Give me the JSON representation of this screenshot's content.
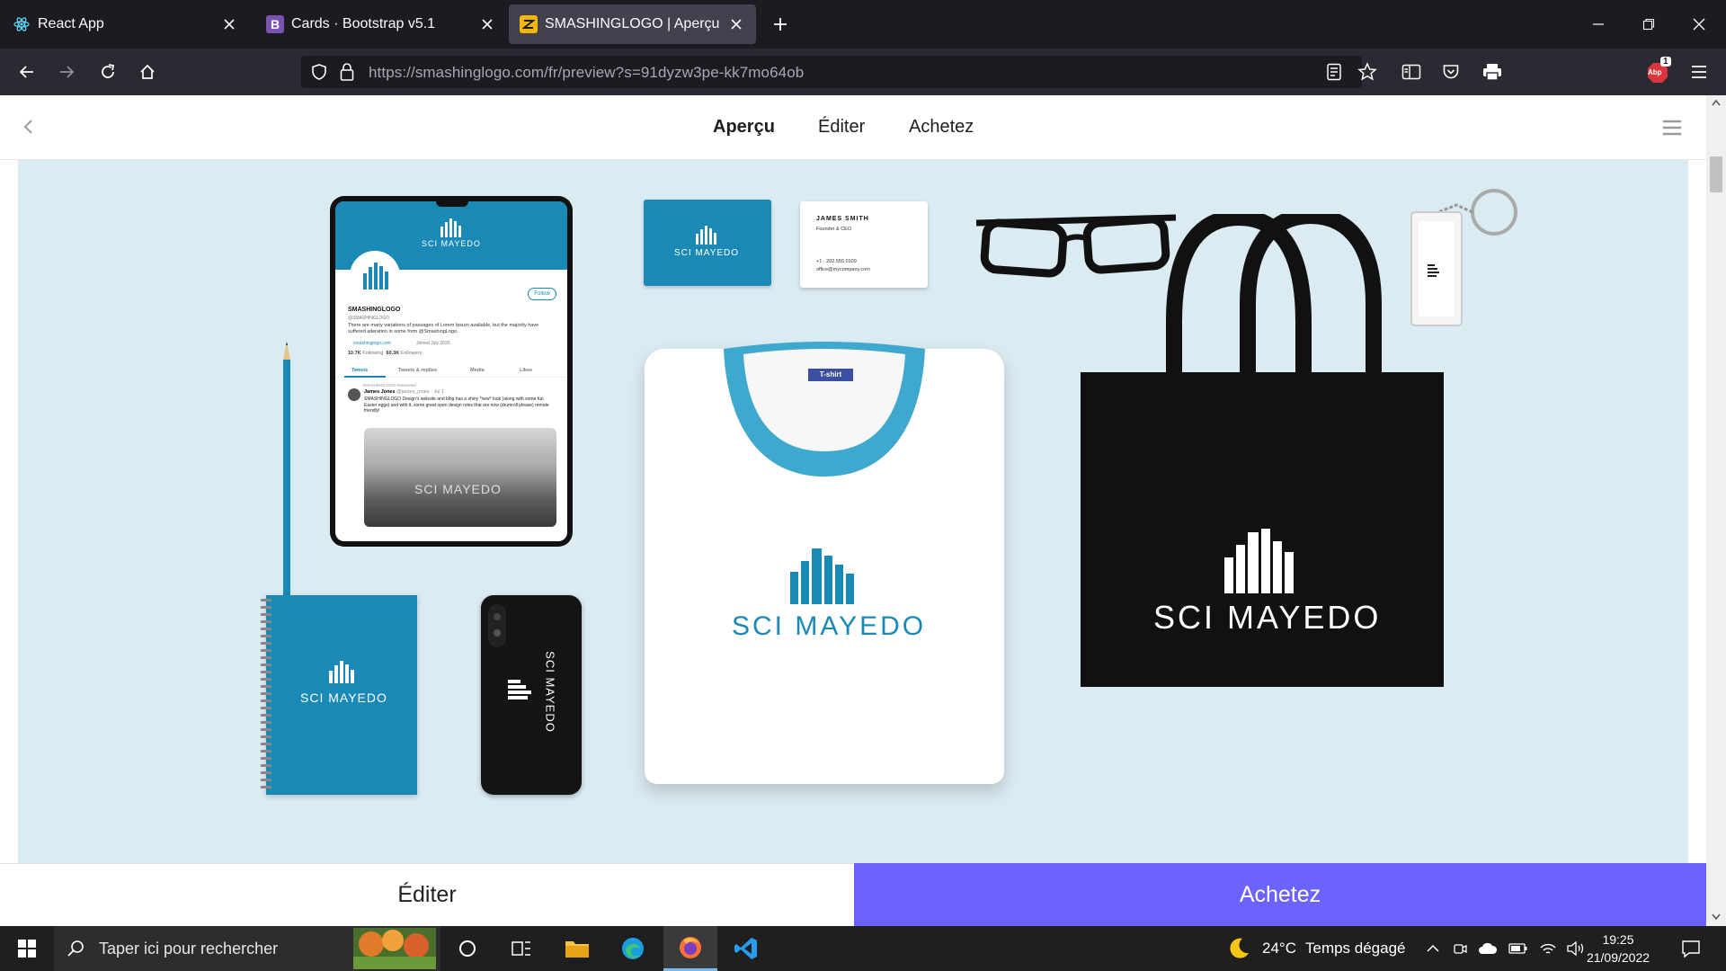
{
  "browser": {
    "tabs": [
      {
        "title": "React App",
        "icon": "react-icon",
        "active": false
      },
      {
        "title": "Cards · Bootstrap v5.1",
        "icon": "bootstrap-icon",
        "active": false
      },
      {
        "title": "SMASHINGLOGO | Aperçu",
        "icon": "smashinglogo-icon",
        "active": true
      }
    ],
    "url_host": "https://smashinglogo.com",
    "url_path": "/fr/preview?s=91dyzw3pe-kk7mo64ob",
    "extension_badge": "1",
    "extension_label": "Abp"
  },
  "site": {
    "nav": {
      "preview": "Aperçu",
      "edit": "Éditer",
      "buy": "Achetez"
    },
    "cta": {
      "edit": "Éditer",
      "buy": "Achetez"
    },
    "accent": "#6c63ff",
    "preview_bg": "#dbebf2",
    "brand_color": "#1a89b5"
  },
  "mockup": {
    "brand_name": "SCI MAYEDO",
    "tablet": {
      "profile_name": "SMASHINGLOGO",
      "handle": "@SMASHINGLOGO",
      "follow": "Follow",
      "bio": "There are many variations of passages of Lorem Ipsum available, but the majority have suffered alteration in some form @SmashingLogo.",
      "link": "smashinglogo.com",
      "joined": "Joined July 2020",
      "following_count": "10.7K",
      "following_label": "Following",
      "followers_count": "60.3K",
      "followers_label": "Followers",
      "tabs": [
        "Tweets",
        "Tweets & replies",
        "Media",
        "Likes"
      ],
      "retweet": "SMASHINGLOGO Retweeted",
      "tweet_author": "James Jones",
      "tweet_meta": "@james_jones · Jul 1",
      "tweet_text": "SMASHINGLOGO Design's website and blog has a shiny *new* look (along with some fun Easter eggs) and with it, some great open design roles that are now (drumroll please) remote friendly!"
    },
    "business_card": {
      "name": "JAMES SMITH",
      "title": "Founder & CEO",
      "phone": "+1 · 202.555.0109",
      "email": "office@mycompany.com"
    },
    "tshirt_tag": "T-shirt"
  },
  "taskbar": {
    "search_placeholder": "Taper ici pour rechercher",
    "weather_temp": "24°C",
    "weather_desc": "Temps dégagé",
    "time": "19:25",
    "date": "21/09/2022"
  }
}
